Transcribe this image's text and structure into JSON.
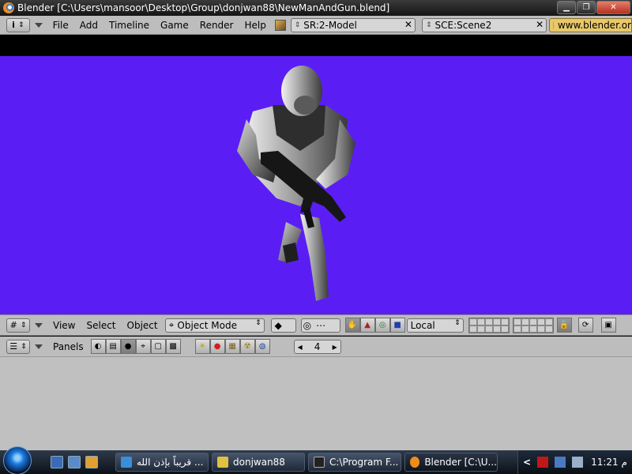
{
  "window": {
    "title": "Blender [C:\\Users\\mansoor\\Desktop\\Group\\donjwan88\\NewManAndGun.blend]",
    "minimize": "▁",
    "maximize": "❐",
    "close": "✕"
  },
  "info_header": {
    "menus": [
      "File",
      "Add",
      "Timeline",
      "Game",
      "Render",
      "Help"
    ],
    "screen_field": "SR:2-Model",
    "scene_field": "SCE:Scene2",
    "url_text": "www.blender.or"
  },
  "view3d_header": {
    "menus": [
      "View",
      "Select",
      "Object"
    ],
    "mode_select": "Object Mode",
    "pivot_orientation": "Local"
  },
  "buttons_header": {
    "panels_label": "Panels",
    "frame_number": "4",
    "frame_prev": "◂",
    "frame_next": "▸"
  },
  "taskbar": {
    "tasks": [
      {
        "label": "قريباً بإذن الله ...",
        "icon_color": "#3a8fd8"
      },
      {
        "label": "donjwan88",
        "icon_color": "#e0c040"
      },
      {
        "label": "C:\\Program F...",
        "icon_color": "#222222"
      },
      {
        "label": "Blender [C:\\U...",
        "icon_color": "#f08c1a"
      }
    ],
    "clock": "11:21 م",
    "tray_arrow": "<"
  },
  "colors": {
    "viewport_bg": "#5a1ef5",
    "ui_grey": "#bdbdbd",
    "url_bg": "#e8c86a"
  },
  "icons": {
    "info": "i",
    "screen_prefix": "⇕",
    "scene_prefix": "⇕",
    "field_clear": "✕",
    "grid": "#",
    "spin": "⇕",
    "buttons_window": "☰"
  }
}
